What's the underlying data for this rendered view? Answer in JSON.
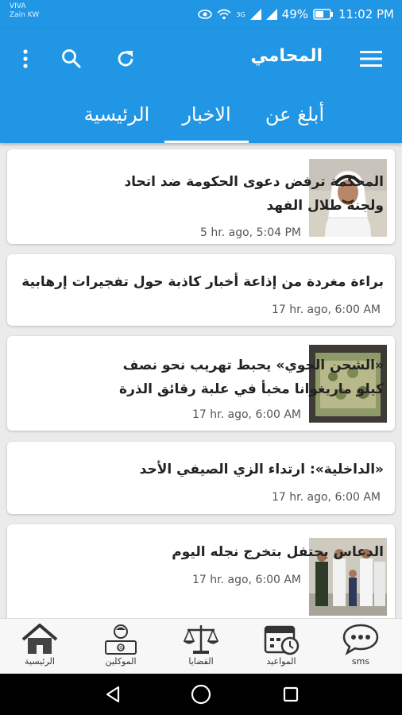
{
  "status_bar": {
    "carrier_line1": "VIVA",
    "carrier_line2": "Zain KW",
    "battery": "49%",
    "time": "11:02 PM",
    "network_label": "3G"
  },
  "app_bar": {
    "title": "المحامي",
    "menu_icon": "hamburger-menu-icon",
    "refresh_icon": "refresh-icon",
    "search_icon": "search-icon",
    "overflow_icon": "more-vert-icon"
  },
  "tabs": [
    {
      "label": "أبلغ عن",
      "selected": false
    },
    {
      "label": "الاخبار",
      "selected": true
    },
    {
      "label": "الرئيسية",
      "selected": false
    }
  ],
  "news": [
    {
      "title_line1": "المحكمة ترفض دعوى الحكومة ضد اتحاد",
      "title_line2": "ولجنة طلال الفهد",
      "time": "5 hr. ago, 5:04 PM",
      "thumb": "person-portrait"
    },
    {
      "title_line1": "براءة مغردة من إذاعة أخبار كاذبة حول تفجيرات إرهابية",
      "title_line2": "",
      "time": "17 hr. ago, 6:00 AM",
      "thumb": ""
    },
    {
      "title_line1": "«الشحن الجوي» يحبط تهريب نحو نصف",
      "title_line2": "كيلو ماريغوانا مخبأ في علبة رقائق الذرة",
      "time": "17 hr. ago, 6:00 AM",
      "thumb": "seized-package"
    },
    {
      "title_line1": "«الداخلية»: ارتداء الزي الصيفي الأحد",
      "title_line2": "",
      "time": "17 hr. ago, 6:00 AM",
      "thumb": ""
    },
    {
      "title_line1": "الدعاس يحتفل بتخرج نجله اليوم",
      "title_line2": "",
      "time": "17 hr. ago, 6:00 AM",
      "thumb": "graduation-group"
    }
  ],
  "bottom_nav": [
    {
      "label": "الرئيسية",
      "icon": "home-icon"
    },
    {
      "label": "الموكلين",
      "icon": "clients-icon"
    },
    {
      "label": "القضايا",
      "icon": "scales-icon"
    },
    {
      "label": "المواعيد",
      "icon": "calendar-clock-icon"
    },
    {
      "label": "sms",
      "icon": "sms-bubble-icon"
    }
  ],
  "colors": {
    "primary": "#2196e4",
    "background": "#ebebeb",
    "card": "#ffffff"
  }
}
